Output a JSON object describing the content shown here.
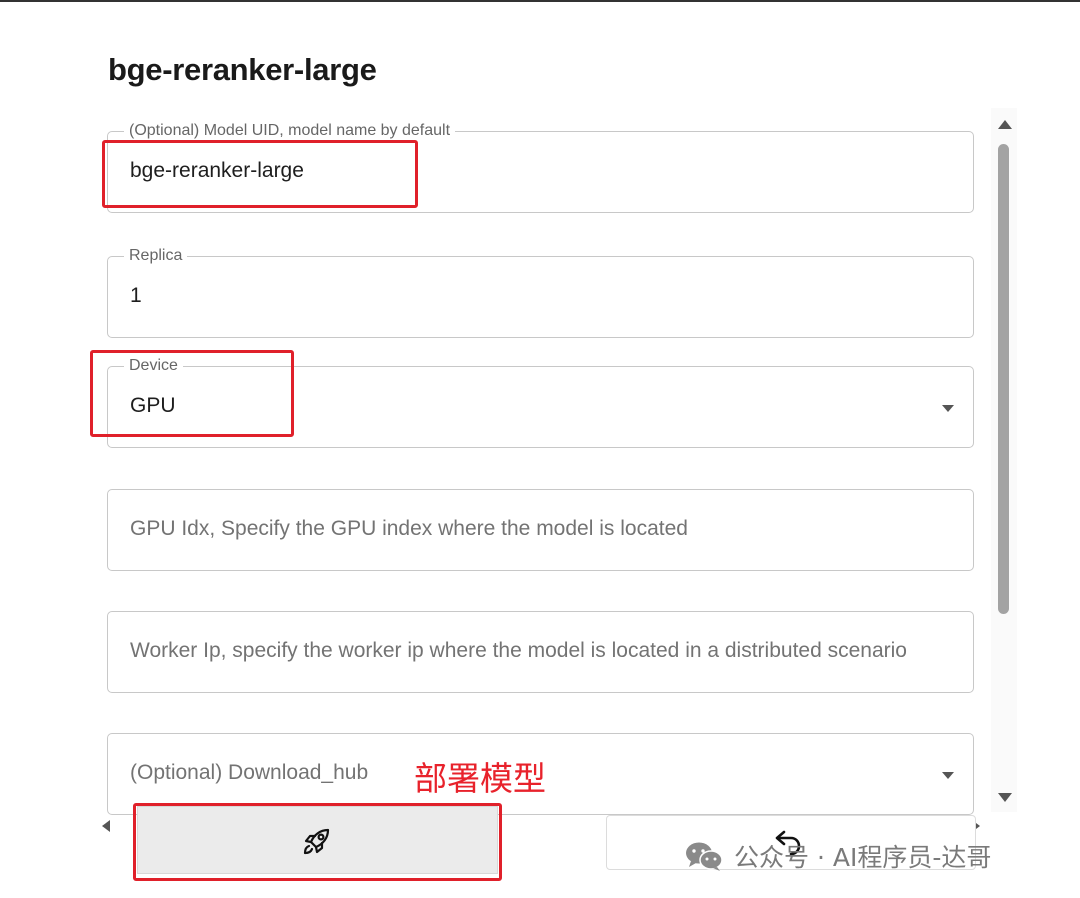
{
  "page": {
    "title": "bge-reranker-large"
  },
  "form": {
    "model_uid": {
      "label": "(Optional) Model UID, model name by default",
      "value": "bge-reranker-large"
    },
    "replica": {
      "label": "Replica",
      "value": "1"
    },
    "device": {
      "label": "Device",
      "value": "GPU"
    },
    "gpu_idx": {
      "placeholder": "GPU Idx, Specify the GPU index where the model is located"
    },
    "worker_ip": {
      "placeholder": "Worker Ip, specify the worker ip where the model is located in a distributed scenario"
    },
    "download_hub": {
      "placeholder": "(Optional) Download_hub"
    }
  },
  "annotation": {
    "text": "部署模型",
    "color": "#e8222b"
  },
  "buttons": {
    "deploy_icon": "rocket-icon",
    "reset_icon": "undo-icon"
  },
  "watermark": {
    "text": "公众号 · AI程序员-达哥",
    "icon": "wechat-icon"
  },
  "colors": {
    "highlight": "#e0202a",
    "border": "#c8c8c8"
  }
}
